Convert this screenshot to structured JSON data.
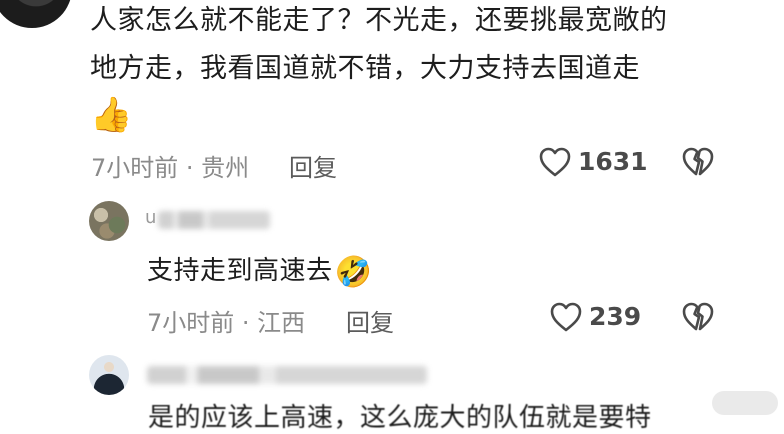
{
  "top_comment": {
    "line1": "人家怎么就不能走了？不光走，还要挑最宽敞的",
    "line2": "地方走，我看国道就不错，大力支持去国道走",
    "emoji": "👍",
    "time_location": "7小时前 · 贵州",
    "reply_label": "回复",
    "like_count": "1631"
  },
  "reply1": {
    "username": "u",
    "text": "支持走到高速去",
    "emoji": "🤣",
    "time_location": "7小时前 · 江西",
    "reply_label": "回复",
    "like_count": "239"
  },
  "reply2": {
    "text_partial": "是的应该上高速，这么庞大的队伍就是要特"
  },
  "icons": {
    "like": "heart-outline-icon",
    "dislike": "broken-heart-icon"
  },
  "colors": {
    "text": "#1d1d1d",
    "meta": "#8a8a8a",
    "icon": "#4a4a4a"
  }
}
